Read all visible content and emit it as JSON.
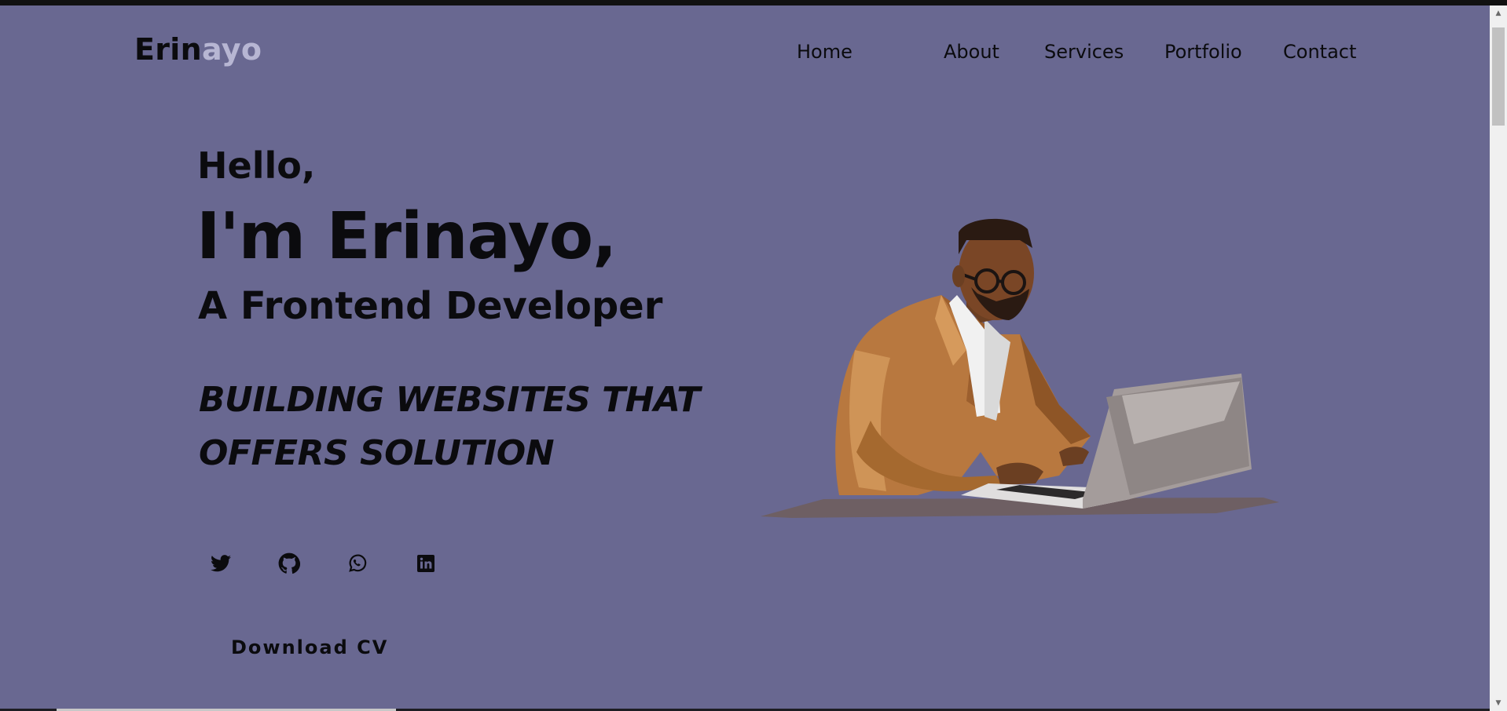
{
  "logo": {
    "part1": "Erin",
    "part2": "ayo"
  },
  "nav": {
    "home": "Home",
    "about": "About",
    "services": "Services",
    "portfolio": "Portfolio",
    "contact": "Contact"
  },
  "hero": {
    "greeting": "Hello,",
    "name": "I'm Erinayo,",
    "role": "A Frontend Developer",
    "tagline_line1": "BUILDING WEBSITES THAT",
    "tagline_line2": "OFFERS SOLUTION"
  },
  "socials": [
    {
      "icon": "twitter-icon"
    },
    {
      "icon": "github-icon"
    },
    {
      "icon": "whatsapp-icon"
    },
    {
      "icon": "linkedin-icon"
    }
  ],
  "cta": {
    "download_label": "Download CV"
  },
  "colors": {
    "background": "#696891",
    "text": "#0b0b0e",
    "logo_accent": "#b7b6d3",
    "jacket": "#b8783f"
  },
  "illustration": {
    "subject": "man-with-laptop-illustration"
  }
}
